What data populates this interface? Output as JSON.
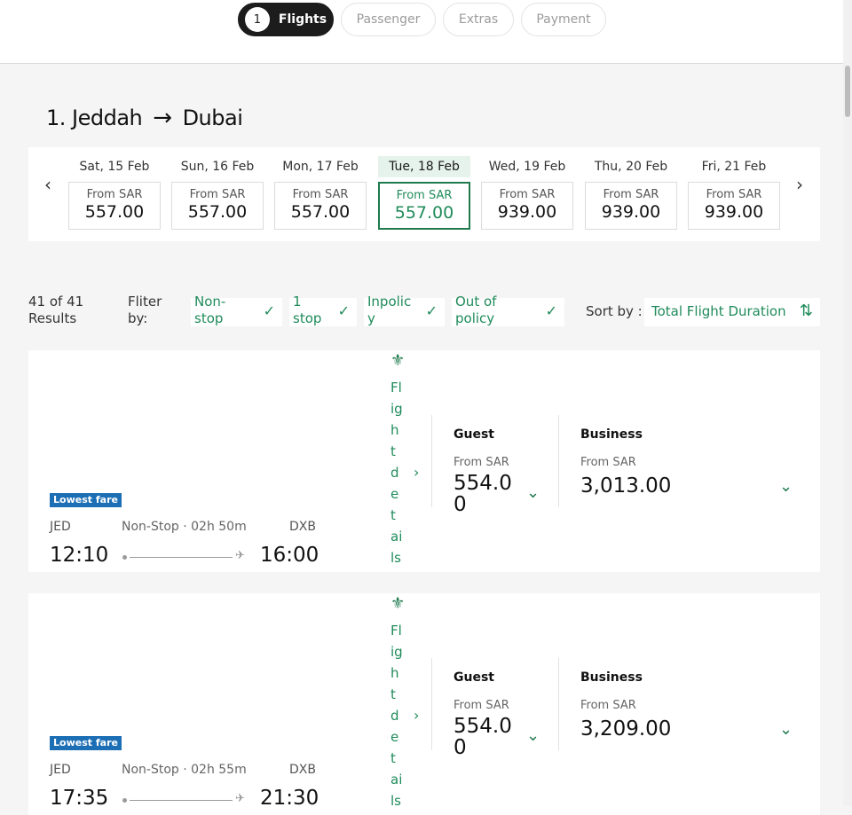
{
  "steps": [
    {
      "num": "1",
      "label": "Flights"
    },
    {
      "label": "Passenger"
    },
    {
      "label": "Extras"
    },
    {
      "label": "Payment"
    }
  ],
  "route": {
    "from": "1. Jeddah",
    "arrow": "→",
    "to": "Dubai"
  },
  "dates": [
    {
      "label": "Sat, 15 Feb",
      "from": "From SAR",
      "price": "557.00"
    },
    {
      "label": "Sun, 16 Feb",
      "from": "From SAR",
      "price": "557.00"
    },
    {
      "label": "Mon, 17 Feb",
      "from": "From SAR",
      "price": "557.00"
    },
    {
      "label": "Tue, 18 Feb",
      "from": "From SAR",
      "price": "557.00",
      "selected": true
    },
    {
      "label": "Wed, 19 Feb",
      "from": "From SAR",
      "price": "939.00"
    },
    {
      "label": "Thu, 20 Feb",
      "from": "From SAR",
      "price": "939.00"
    },
    {
      "label": "Fri, 21 Feb",
      "from": "From SAR",
      "price": "939.00"
    }
  ],
  "results": {
    "count": "41 of 41 Results"
  },
  "filter": {
    "label": "Fliter by:",
    "chips": [
      "Non-stop",
      "1 stop",
      "Inpolicy",
      "Out of policy"
    ]
  },
  "sort": {
    "label": "Sort by :",
    "value": "Total Flight Duration"
  },
  "flights": [
    {
      "badge": "Lowest fare",
      "origin": "JED",
      "destination": "DXB",
      "stops": "Non-Stop · 02h 50m",
      "depart": "12:10",
      "arrive": "16:00",
      "details": "Flight details",
      "fares": [
        {
          "name": "Guest",
          "from": "From SAR",
          "price": "554.00"
        },
        {
          "name": "Business",
          "from": "From SAR",
          "price": "3,013.00"
        }
      ]
    },
    {
      "badge": "Lowest fare",
      "origin": "JED",
      "destination": "DXB",
      "stops": "Non-Stop · 02h 55m",
      "depart": "17:35",
      "arrive": "21:30",
      "details": "Flight details",
      "fares": [
        {
          "name": "Guest",
          "from": "From SAR",
          "price": "554.00"
        },
        {
          "name": "Business",
          "from": "From SAR",
          "price": "3,209.00"
        }
      ]
    }
  ],
  "icons": {
    "chev_left": "‹",
    "chev_right": "›",
    "check": "✓",
    "sort": "⇅",
    "plane": "✈",
    "airline_logo": "⚜",
    "chev_down": "⌄"
  },
  "colors": {
    "brand": "#1f7a4d",
    "accent": "#1f8b5a",
    "badge": "#1d6fb5",
    "dark": "#1c1c1c"
  }
}
